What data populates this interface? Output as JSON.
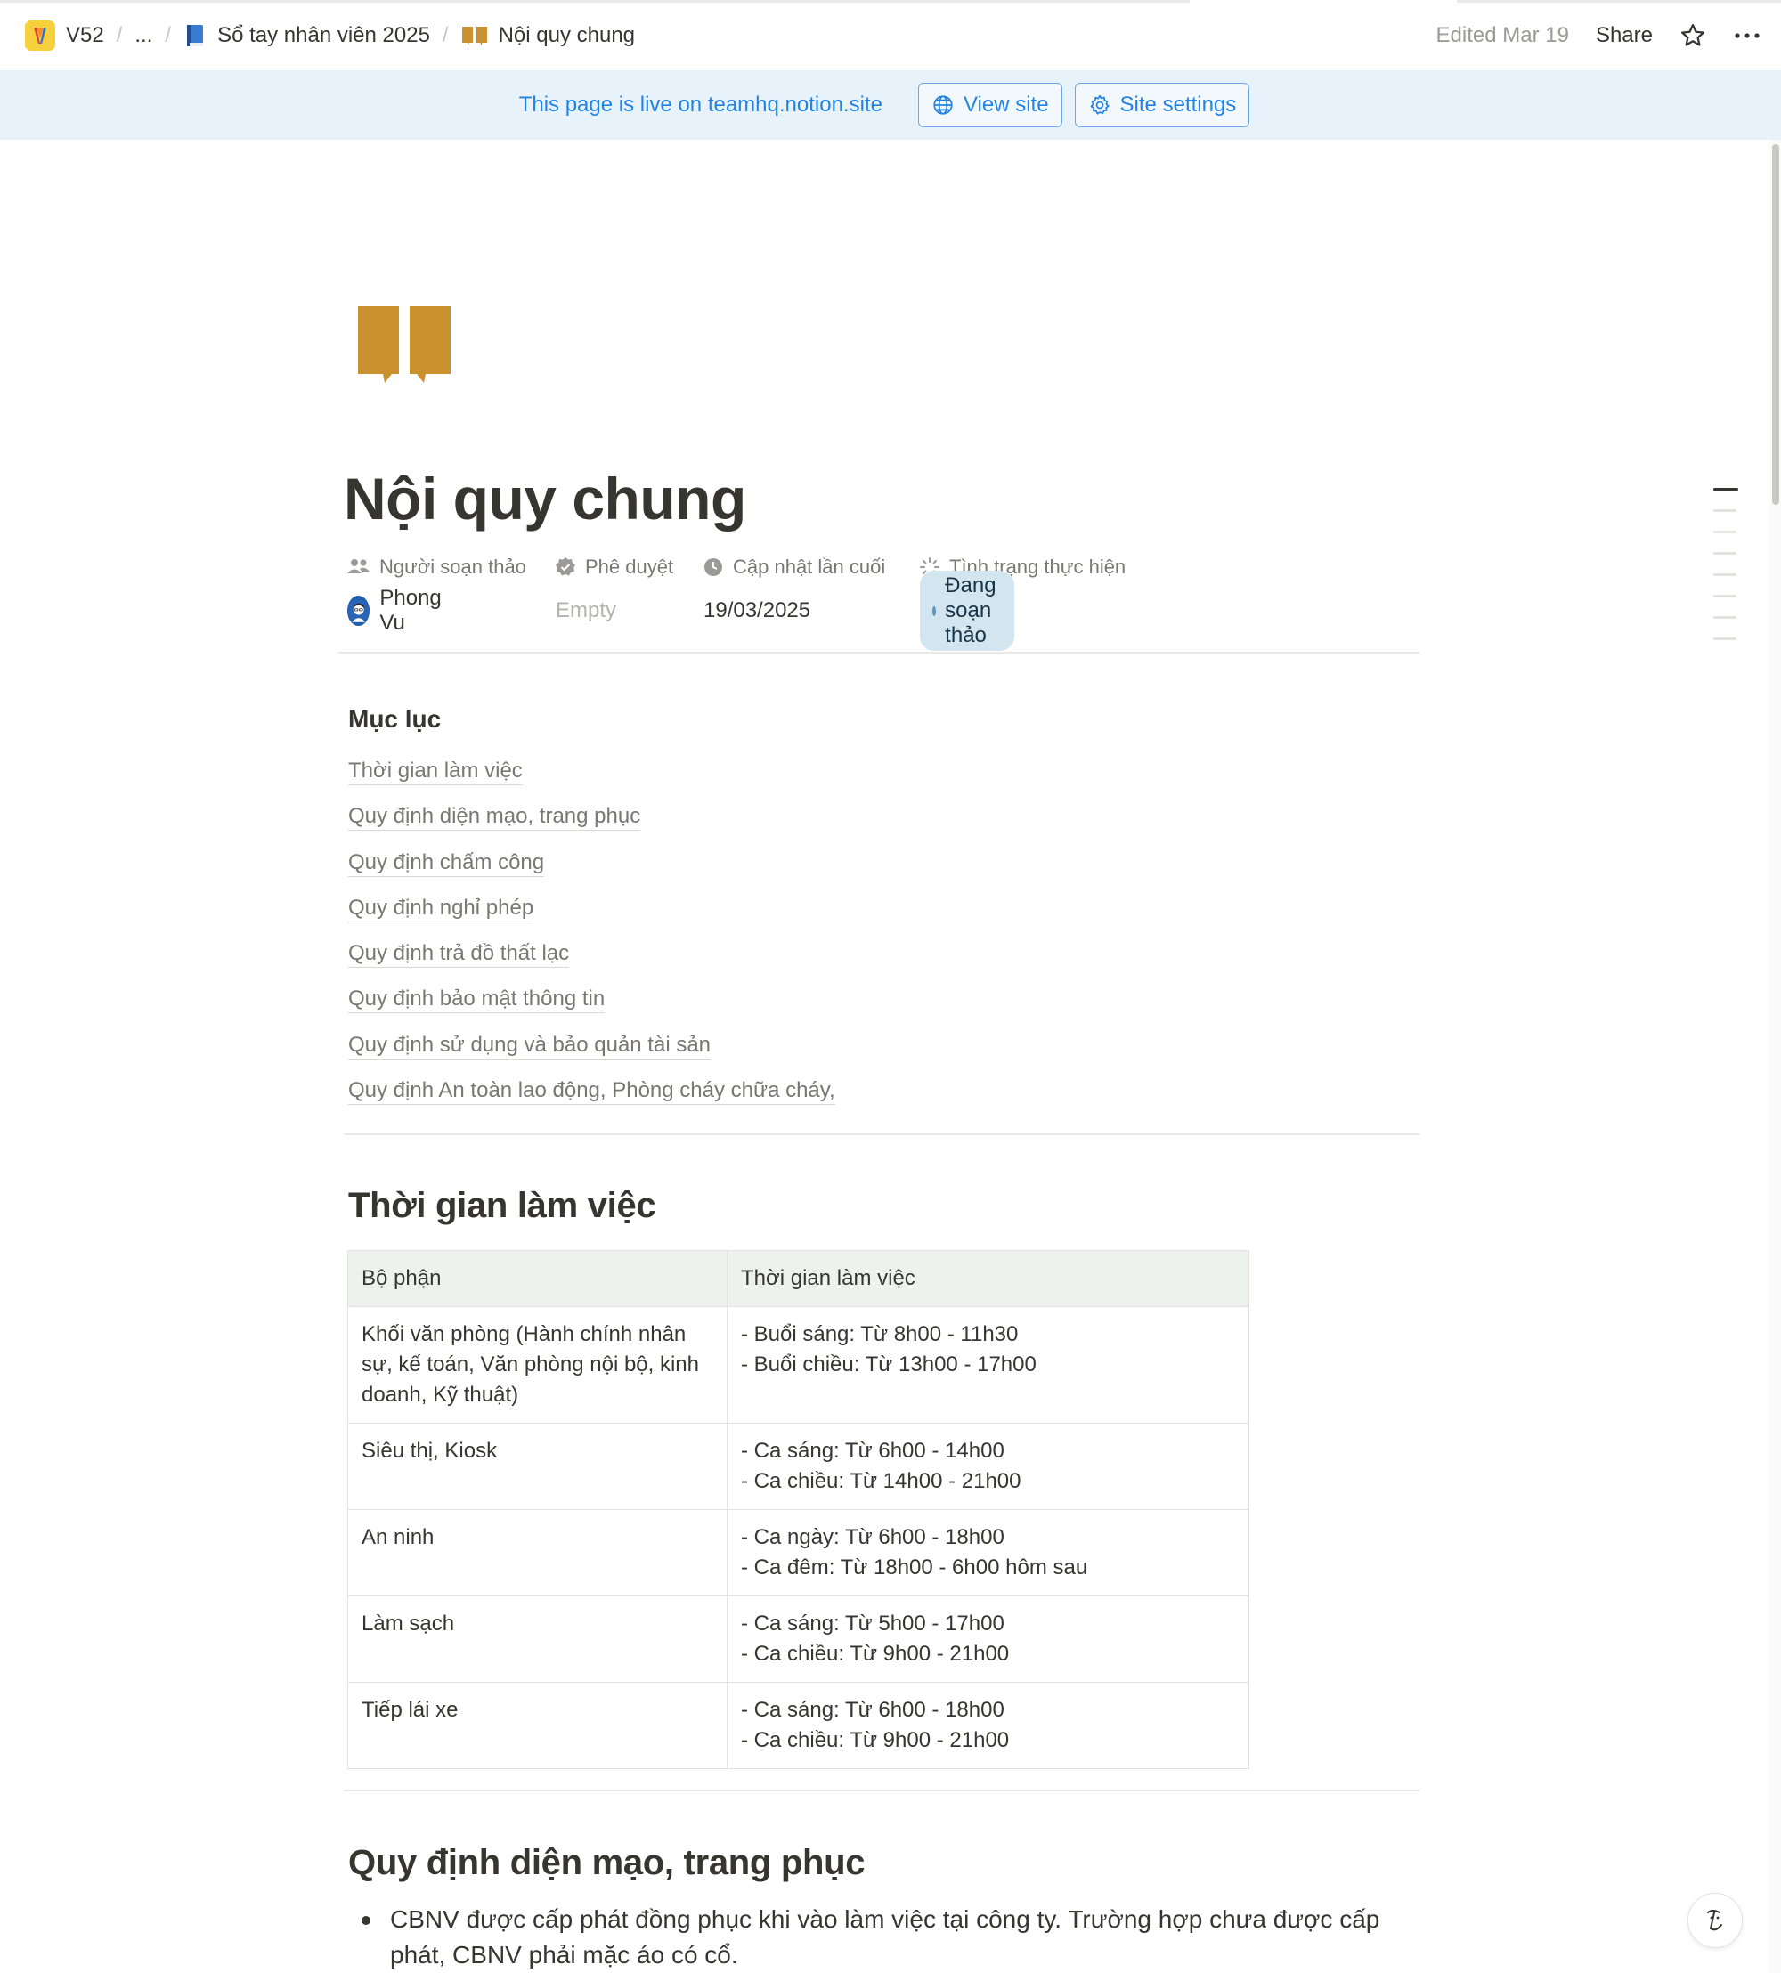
{
  "breadcrumb": {
    "workspace": "V52",
    "ellipsis": "...",
    "parent": "Sổ tay nhân viên 2025",
    "current": "Nội quy chung"
  },
  "topbar": {
    "edited": "Edited Mar 19",
    "share": "Share"
  },
  "banner": {
    "text": "This page is live on teamhq.notion.site",
    "view_site": "View site",
    "site_settings": "Site settings"
  },
  "page": {
    "icon": "book-icon",
    "title": "Nội quy chung"
  },
  "properties": {
    "author_label": "Người soạn thảo",
    "approval_label": "Phê duyệt",
    "updated_label": "Cập nhật lần cuối",
    "status_label": "Tình trạng thực hiện",
    "author_value": "Phong Vu",
    "approval_value": "Empty",
    "updated_value": "19/03/2025",
    "status_value": "Đang soạn thảo",
    "status_color": "#d3e5ef"
  },
  "toc": {
    "title": "Mục lục",
    "items": [
      "Thời gian làm việc",
      "Quy định diện mạo, trang phục",
      "Quy định chấm công",
      "Quy định nghỉ phép",
      "Quy định trả đồ thất lạc",
      "Quy định bảo mật thông tin",
      "Quy định sử dụng và bảo quản tài sản",
      "Quy định An toàn lao động, Phòng cháy chữa cháy,"
    ]
  },
  "section1": {
    "heading": "Thời gian làm việc",
    "table": {
      "headers": [
        "Bộ phận",
        "Thời gian làm việc"
      ],
      "rows": [
        {
          "dept": "Khối văn phòng (Hành chính nhân sự, kế toán, Văn phòng nội bộ, kinh doanh, Kỹ thuật)",
          "line1": "- Buổi sáng: Từ 8h00 - 11h30",
          "line2": "- Buổi chiều: Từ 13h00 - 17h00"
        },
        {
          "dept": "Siêu thị, Kiosk",
          "line1": "- Ca sáng: Từ 6h00 - 14h00",
          "line2": "- Ca chiều: Từ 14h00 - 21h00"
        },
        {
          "dept": "An ninh",
          "line1": "- Ca ngày: Từ 6h00 - 18h00",
          "line2": "- Ca đêm: Từ 18h00 - 6h00 hôm sau"
        },
        {
          "dept": "Làm sạch",
          "line1": "- Ca sáng: Từ 5h00 - 17h00",
          "line2": "- Ca chiều: Từ 9h00 - 21h00"
        },
        {
          "dept": "Tiếp lái xe",
          "line1": "- Ca sáng: Từ 6h00 - 18h00",
          "line2": "- Ca chiều: Từ 9h00 - 21h00"
        }
      ]
    }
  },
  "section2": {
    "heading": "Quy định diện mạo, trang phục",
    "bullet1": "CBNV được cấp phát đồng phục khi vào làm việc tại công ty. Trường hợp chưa được cấp phát, CBNV phải mặc áo có cổ."
  },
  "colors": {
    "accent": "#2383e2",
    "banner_bg": "#e8f2fb",
    "page_icon": "#cb912f",
    "table_header_bg": "#edf3ec"
  }
}
